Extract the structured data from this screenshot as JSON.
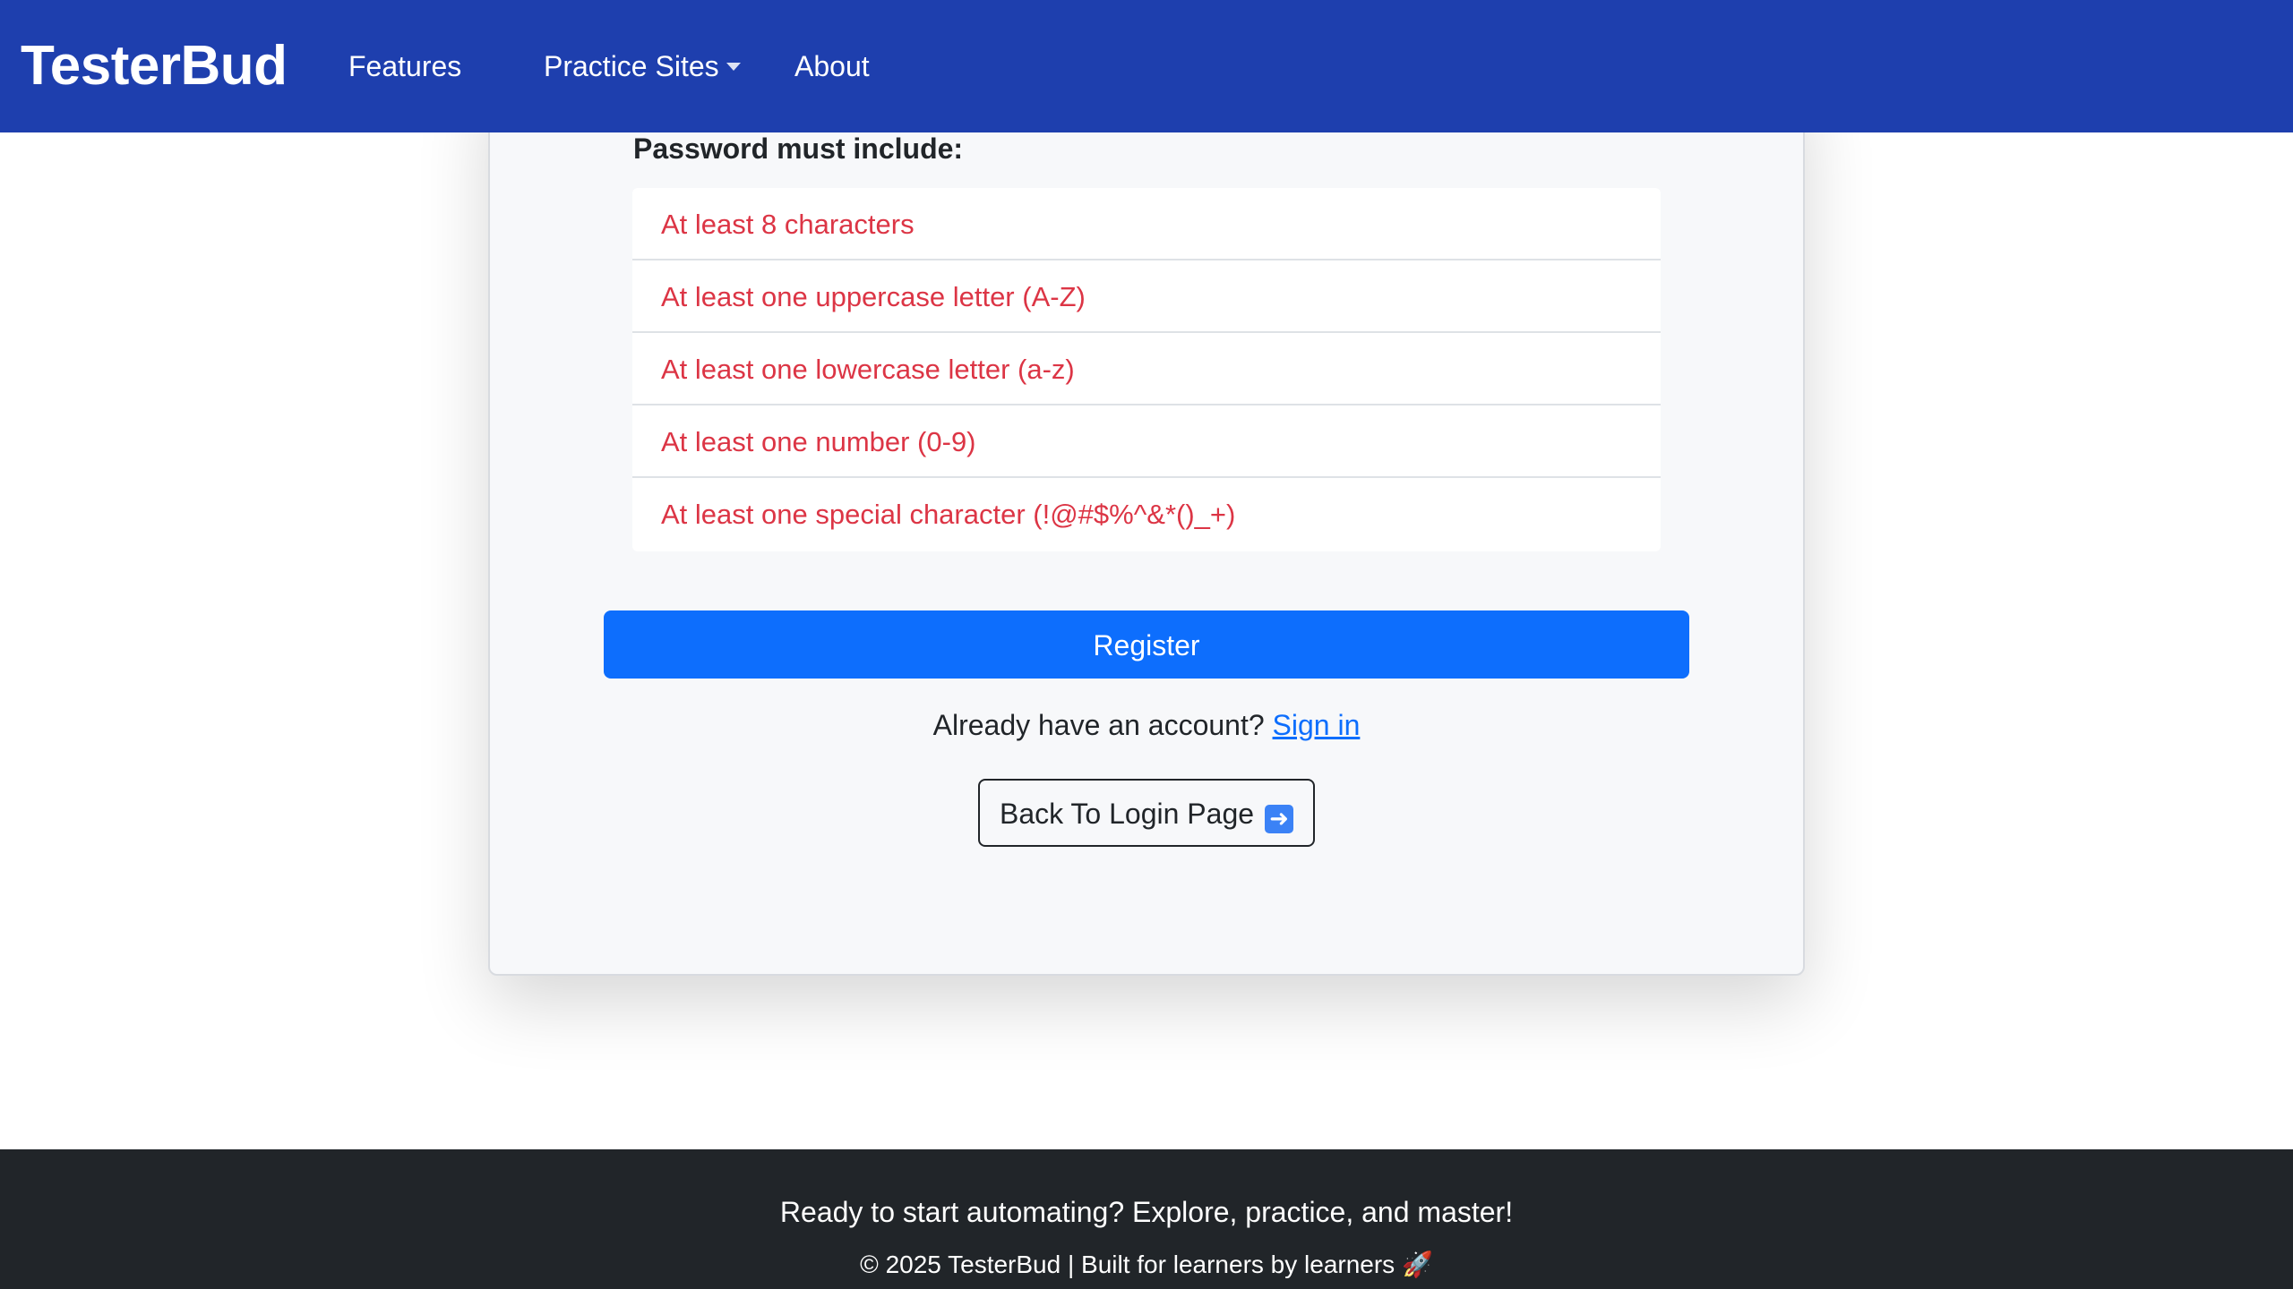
{
  "navbar": {
    "brand": "TesterBud",
    "links": [
      {
        "label": "Features"
      },
      {
        "label": "Practice Sites",
        "has_dropdown": true
      },
      {
        "label": "About"
      }
    ],
    "background_color": "#1e3fae"
  },
  "requirements": {
    "title": "Password must include:",
    "items": [
      "At least 8 characters",
      "At least one uppercase letter (A-Z)",
      "At least one lowercase letter (a-z)",
      "At least one number (0-9)",
      "At least one special character (!@#$%^&*()_+)"
    ],
    "status_color": "#dc3545"
  },
  "form": {
    "register_label": "Register",
    "signin_prompt": "Already have an account?",
    "signin_link": "Sign in",
    "back_label": "Back To Login Page",
    "back_icon": "right-arrow-icon",
    "accent_color": "#0d6efd"
  },
  "footer": {
    "tagline": "Ready to start automating? Explore, practice, and master!",
    "copyright": "© 2025 TesterBud | Built for learners by learners",
    "icon": "rocket-icon",
    "background_color": "#212529"
  }
}
